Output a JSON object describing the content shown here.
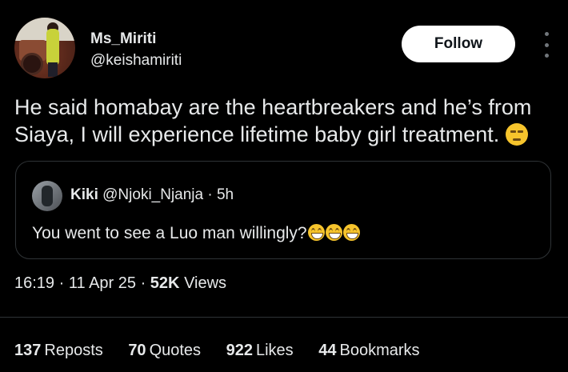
{
  "author": {
    "name": "Ms_Miriti",
    "handle": "@keishamiriti",
    "follow_label": "Follow"
  },
  "tweet": {
    "text": "He said homabay are the heartbreakers and he’s from Siaya, I will experience lifetime baby girl treatment.",
    "emoji": "unamused-face"
  },
  "quoted": {
    "name": "Kiki",
    "handle": "@Njoki_Njanja",
    "separator": "·",
    "time": "5h",
    "text": "You went to see a Luo man willingly?",
    "emojis": [
      "grinning-face",
      "grinning-face",
      "grinning-face"
    ]
  },
  "meta": {
    "time": "16:19",
    "sep1": "·",
    "date": "11 Apr 25",
    "sep2": "·",
    "views_count": "52K",
    "views_label": "Views"
  },
  "stats": [
    {
      "count": "137",
      "label": "Reposts"
    },
    {
      "count": "70",
      "label": "Quotes"
    },
    {
      "count": "922",
      "label": "Likes"
    },
    {
      "count": "44",
      "label": "Bookmarks"
    }
  ]
}
